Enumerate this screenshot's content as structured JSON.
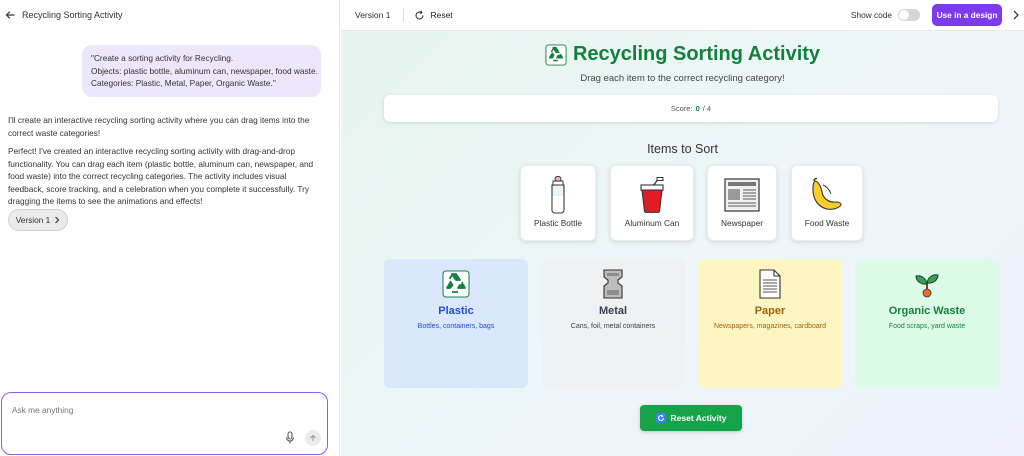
{
  "left": {
    "title": "Recycling Sorting Activity",
    "user_message": [
      "\"Create a sorting activity for Recycling.",
      "Objects: plastic bottle, aluminum can, newspaper, food waste.",
      "Categories: Plastic, Metal, Paper, Organic Waste.\""
    ],
    "assistant_messages": [
      "I'll create an interactive recycling sorting activity where you can drag items into the correct waste categories!",
      "Perfect! I've created an interactive recycling sorting activity with drag-and-drop functionality. You can drag each item (plastic bottle, aluminum can, newspaper, and food waste) into the correct recycling categories. The activity includes visual feedback, score tracking, and a celebration when you complete it successfully. Try dragging the items to see the animations and effects!"
    ],
    "version_chip": "Version 1",
    "chat_placeholder": "Ask me anything"
  },
  "toolbar": {
    "version": "Version 1",
    "reset": "Reset",
    "show_code": "Show code",
    "use_design": "Use in a design"
  },
  "app": {
    "title": "Recycling Sorting Activity",
    "subtitle": "Drag each item to the correct recycling category!",
    "score_label": "Score:",
    "score_value": "0",
    "score_total": "/ 4",
    "items_title": "Items to Sort",
    "items": [
      {
        "label": "Plastic Bottle",
        "icon": "baby-bottle-icon"
      },
      {
        "label": "Aluminum Can",
        "icon": "cup-with-straw-icon"
      },
      {
        "label": "Newspaper",
        "icon": "newspaper-icon"
      },
      {
        "label": "Food Waste",
        "icon": "banana-icon"
      }
    ],
    "bins": [
      {
        "name": "Plastic",
        "desc": "Bottles, containers, bags",
        "icon": "recycle-icon",
        "bg": "#dbe7fd",
        "name_color": "#1d4ed8",
        "desc_color": "#1d4ed8"
      },
      {
        "name": "Metal",
        "desc": "Cans, foil, metal containers",
        "icon": "metal-icon",
        "bg": "#f0f1f3",
        "name_color": "#374151",
        "desc_color": "#374151"
      },
      {
        "name": "Paper",
        "desc": "Newspapers, magazines, cardboard",
        "icon": "page-icon",
        "bg": "#fdf6c3",
        "name_color": "#a16207",
        "desc_color": "#a16207"
      },
      {
        "name": "Organic Waste",
        "desc": "Food scraps, yard waste",
        "icon": "seedling-icon",
        "bg": "#dcfce7",
        "name_color": "#15803d",
        "desc_color": "#15803d"
      }
    ],
    "reset_button": "Reset Activity"
  },
  "colors": {
    "accent": "#7c3aed",
    "title_green": "#15803d",
    "button_green": "#16a34a"
  }
}
